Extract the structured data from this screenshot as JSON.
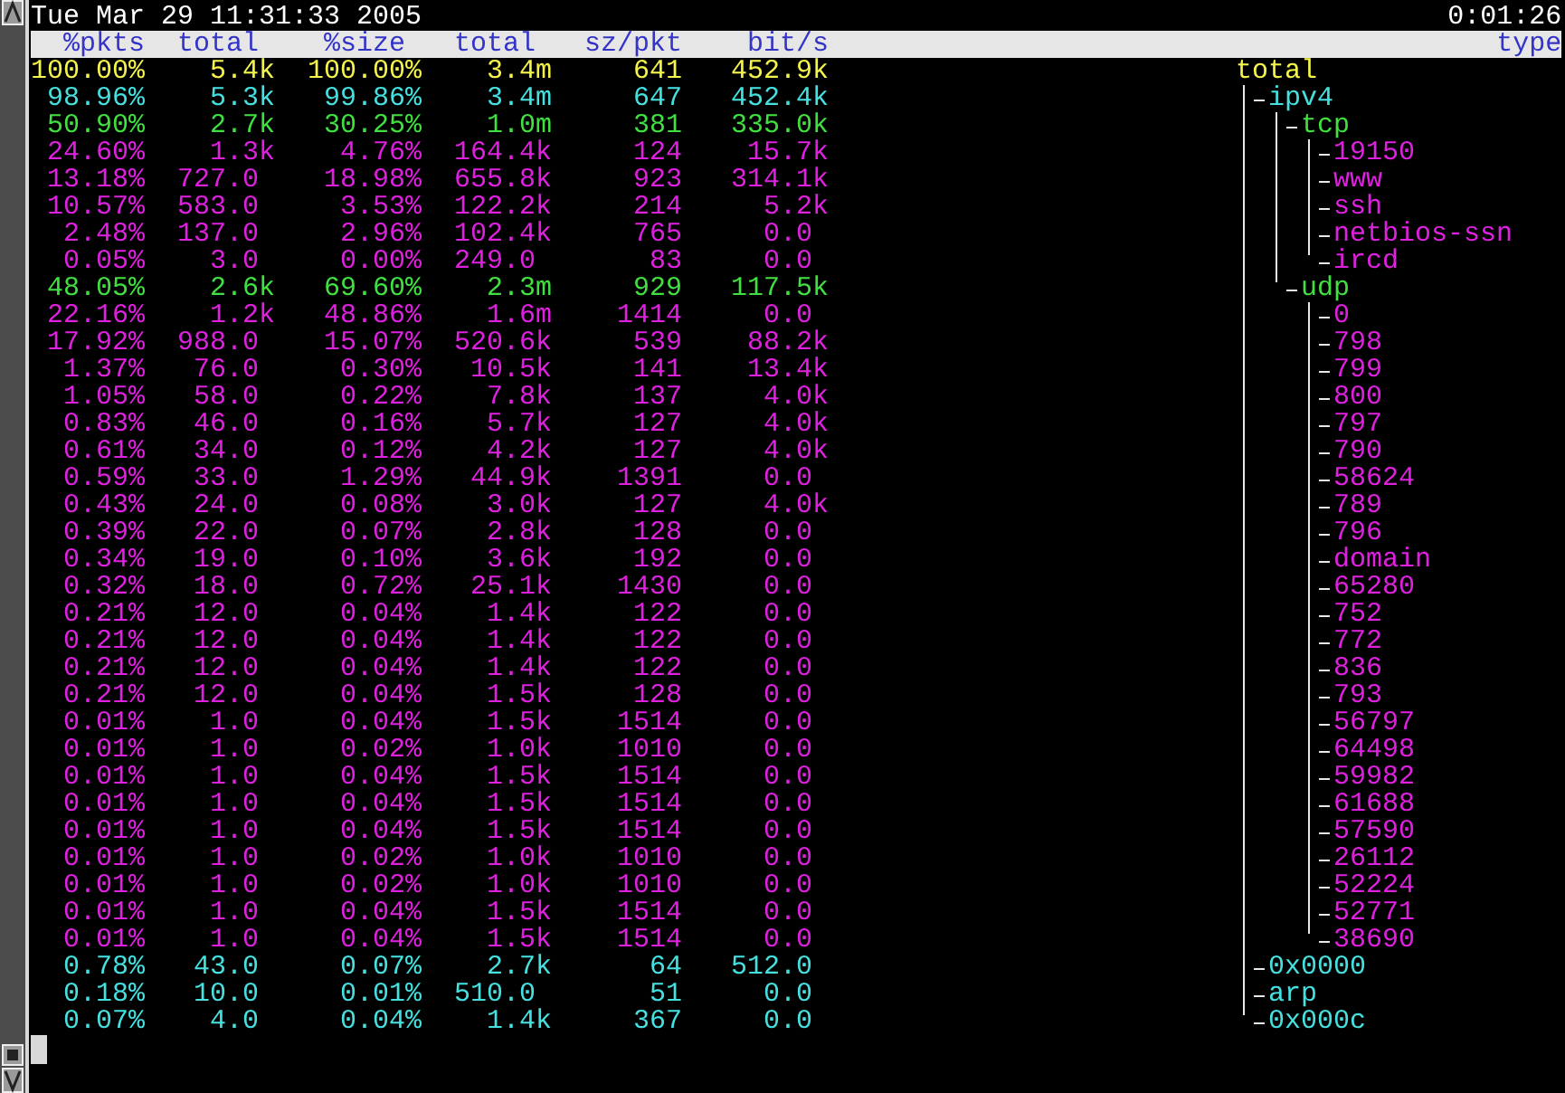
{
  "status_line": {
    "date": "Tue Mar 29 11:31:33 2005",
    "elapsed": "0:01:26"
  },
  "columns": [
    "%pkts",
    "total",
    "%size",
    "total",
    "sz/pkt",
    "bit/s",
    "type"
  ],
  "tree": {
    "label": "total",
    "values": [
      "100.00%",
      "5.4k",
      "100.00%",
      "3.4m",
      "641",
      "452.9k"
    ],
    "children": [
      {
        "label": "ipv4",
        "values": [
          "98.96%",
          "5.3k",
          "99.86%",
          "3.4m",
          "647",
          "452.4k"
        ],
        "children": [
          {
            "label": "tcp",
            "values": [
              "50.90%",
              "2.7k",
              "30.25%",
              "1.0m",
              "381",
              "335.0k"
            ],
            "children": [
              {
                "label": "19150",
                "values": [
                  "24.60%",
                  "1.3k",
                  "4.76%",
                  "164.4k",
                  "124",
                  "15.7k"
                ]
              },
              {
                "label": "www",
                "values": [
                  "13.18%",
                  "727.0",
                  "18.98%",
                  "655.8k",
                  "923",
                  "314.1k"
                ]
              },
              {
                "label": "ssh",
                "values": [
                  "10.57%",
                  "583.0",
                  "3.53%",
                  "122.2k",
                  "214",
                  "5.2k"
                ]
              },
              {
                "label": "netbios-ssn",
                "values": [
                  "2.48%",
                  "137.0",
                  "2.96%",
                  "102.4k",
                  "765",
                  "0.0"
                ]
              },
              {
                "label": "ircd",
                "values": [
                  "0.05%",
                  "3.0",
                  "0.00%",
                  "249.0",
                  "83",
                  "0.0"
                ]
              }
            ]
          },
          {
            "label": "udp",
            "values": [
              "48.05%",
              "2.6k",
              "69.60%",
              "2.3m",
              "929",
              "117.5k"
            ],
            "children": [
              {
                "label": "0",
                "values": [
                  "22.16%",
                  "1.2k",
                  "48.86%",
                  "1.6m",
                  "1414",
                  "0.0"
                ]
              },
              {
                "label": "798",
                "values": [
                  "17.92%",
                  "988.0",
                  "15.07%",
                  "520.6k",
                  "539",
                  "88.2k"
                ]
              },
              {
                "label": "799",
                "values": [
                  "1.37%",
                  "76.0",
                  "0.30%",
                  "10.5k",
                  "141",
                  "13.4k"
                ]
              },
              {
                "label": "800",
                "values": [
                  "1.05%",
                  "58.0",
                  "0.22%",
                  "7.8k",
                  "137",
                  "4.0k"
                ]
              },
              {
                "label": "797",
                "values": [
                  "0.83%",
                  "46.0",
                  "0.16%",
                  "5.7k",
                  "127",
                  "4.0k"
                ]
              },
              {
                "label": "790",
                "values": [
                  "0.61%",
                  "34.0",
                  "0.12%",
                  "4.2k",
                  "127",
                  "4.0k"
                ]
              },
              {
                "label": "58624",
                "values": [
                  "0.59%",
                  "33.0",
                  "1.29%",
                  "44.9k",
                  "1391",
                  "0.0"
                ]
              },
              {
                "label": "789",
                "values": [
                  "0.43%",
                  "24.0",
                  "0.08%",
                  "3.0k",
                  "127",
                  "4.0k"
                ]
              },
              {
                "label": "796",
                "values": [
                  "0.39%",
                  "22.0",
                  "0.07%",
                  "2.8k",
                  "128",
                  "0.0"
                ]
              },
              {
                "label": "domain",
                "values": [
                  "0.34%",
                  "19.0",
                  "0.10%",
                  "3.6k",
                  "192",
                  "0.0"
                ]
              },
              {
                "label": "65280",
                "values": [
                  "0.32%",
                  "18.0",
                  "0.72%",
                  "25.1k",
                  "1430",
                  "0.0"
                ]
              },
              {
                "label": "752",
                "values": [
                  "0.21%",
                  "12.0",
                  "0.04%",
                  "1.4k",
                  "122",
                  "0.0"
                ]
              },
              {
                "label": "772",
                "values": [
                  "0.21%",
                  "12.0",
                  "0.04%",
                  "1.4k",
                  "122",
                  "0.0"
                ]
              },
              {
                "label": "836",
                "values": [
                  "0.21%",
                  "12.0",
                  "0.04%",
                  "1.4k",
                  "122",
                  "0.0"
                ]
              },
              {
                "label": "793",
                "values": [
                  "0.21%",
                  "12.0",
                  "0.04%",
                  "1.5k",
                  "128",
                  "0.0"
                ]
              },
              {
                "label": "56797",
                "values": [
                  "0.01%",
                  "1.0",
                  "0.04%",
                  "1.5k",
                  "1514",
                  "0.0"
                ]
              },
              {
                "label": "64498",
                "values": [
                  "0.01%",
                  "1.0",
                  "0.02%",
                  "1.0k",
                  "1010",
                  "0.0"
                ]
              },
              {
                "label": "59982",
                "values": [
                  "0.01%",
                  "1.0",
                  "0.04%",
                  "1.5k",
                  "1514",
                  "0.0"
                ]
              },
              {
                "label": "61688",
                "values": [
                  "0.01%",
                  "1.0",
                  "0.04%",
                  "1.5k",
                  "1514",
                  "0.0"
                ]
              },
              {
                "label": "57590",
                "values": [
                  "0.01%",
                  "1.0",
                  "0.04%",
                  "1.5k",
                  "1514",
                  "0.0"
                ]
              },
              {
                "label": "26112",
                "values": [
                  "0.01%",
                  "1.0",
                  "0.02%",
                  "1.0k",
                  "1010",
                  "0.0"
                ]
              },
              {
                "label": "52224",
                "values": [
                  "0.01%",
                  "1.0",
                  "0.02%",
                  "1.0k",
                  "1010",
                  "0.0"
                ]
              },
              {
                "label": "52771",
                "values": [
                  "0.01%",
                  "1.0",
                  "0.04%",
                  "1.5k",
                  "1514",
                  "0.0"
                ]
              },
              {
                "label": "38690",
                "values": [
                  "0.01%",
                  "1.0",
                  "0.04%",
                  "1.5k",
                  "1514",
                  "0.0"
                ]
              }
            ]
          }
        ]
      },
      {
        "label": "0x0000",
        "values": [
          "0.78%",
          "43.0",
          "0.07%",
          "2.7k",
          "64",
          "512.0"
        ]
      },
      {
        "label": "arp",
        "values": [
          "0.18%",
          "10.0",
          "0.01%",
          "510.0",
          "51",
          "0.0"
        ]
      },
      {
        "label": "0x000c",
        "values": [
          "0.07%",
          "4.0",
          "0.04%",
          "1.4k",
          "367",
          "0.0"
        ]
      }
    ]
  }
}
